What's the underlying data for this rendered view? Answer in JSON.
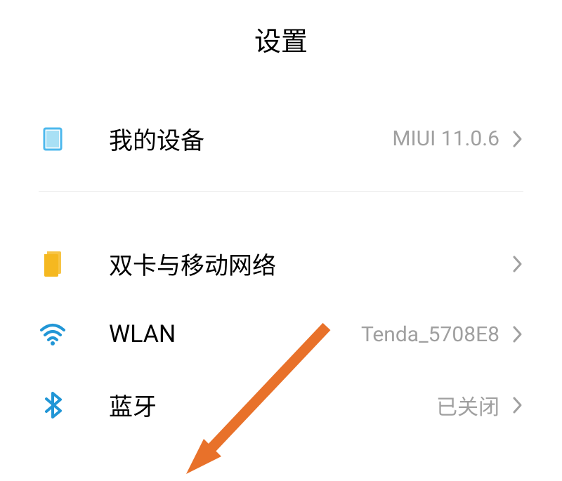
{
  "header": {
    "title": "设置"
  },
  "items": {
    "my_device": {
      "label": "我的设备",
      "value": "MIUI 11.0.6"
    },
    "dual_sim": {
      "label": "双卡与移动网络",
      "value": ""
    },
    "wlan": {
      "label": "WLAN",
      "value": "Tenda_5708E8"
    },
    "bluetooth": {
      "label": "蓝牙",
      "value": "已关闭"
    }
  }
}
